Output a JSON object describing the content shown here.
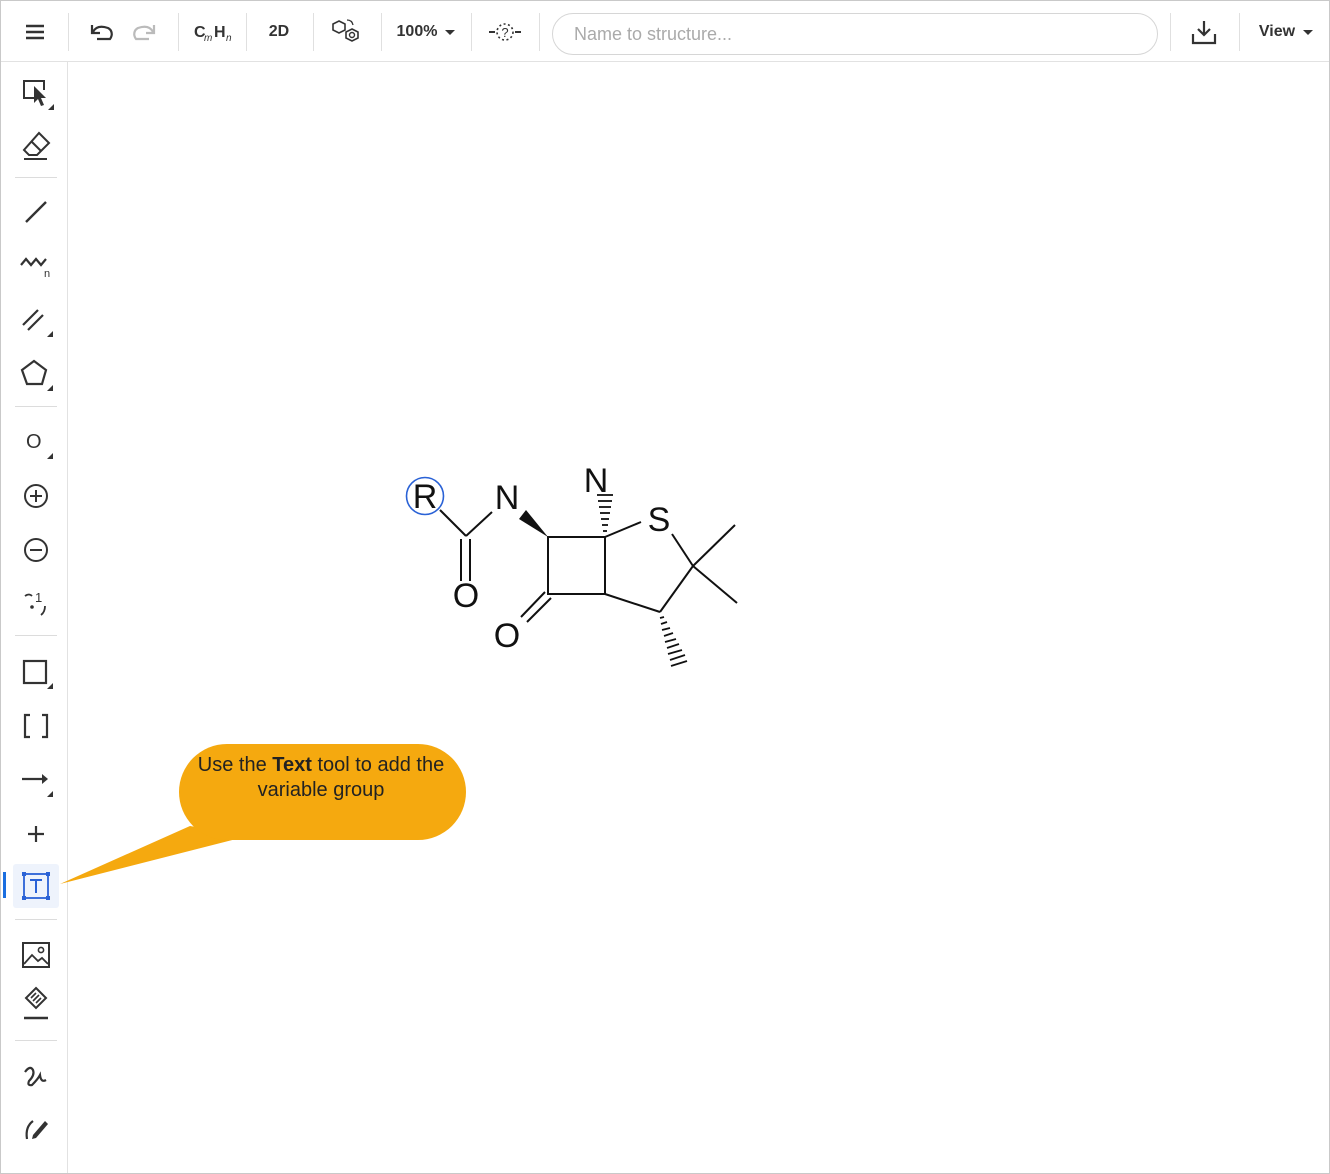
{
  "toolbar": {
    "menu_icon": "hamburger-menu-icon",
    "formula_label": "CmHn",
    "mode_label": "2D",
    "zoom_value": "100%",
    "search_placeholder": "Name to structure...",
    "view_label": "View"
  },
  "molecule": {
    "atoms": {
      "r_group": "R",
      "amide_n": "N",
      "ring_n": "N",
      "sulfur": "S",
      "carbonyl_o_1": "O",
      "carbonyl_o_2": "O"
    }
  },
  "callout": {
    "text_before": "Use the ",
    "text_bold": "Text",
    "text_after": " tool to add the variable group"
  },
  "colors": {
    "callout_fill": "#f5a90f",
    "active_tool": "#2a62d6",
    "selection_ring": "#2a62d6"
  }
}
